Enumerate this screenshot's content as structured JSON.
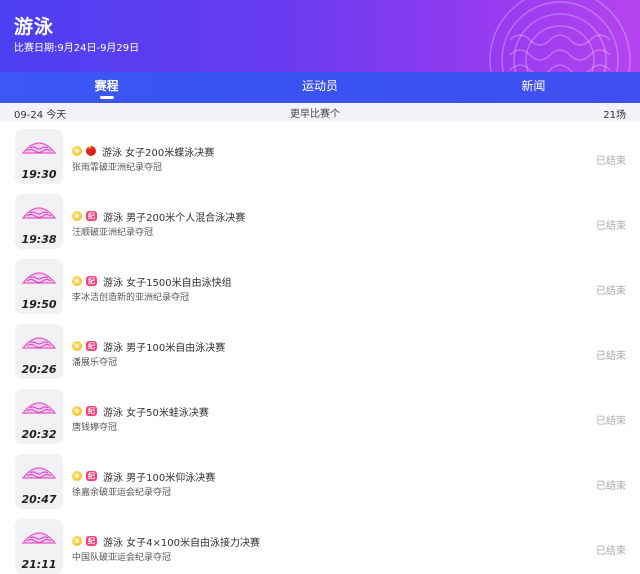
{
  "header": {
    "title": "游泳",
    "date_range": "比赛日期:9月24日-9月29日",
    "colors": {
      "gradient_start": "#4d3ff2",
      "gradient_end": "#b545ee",
      "tab_bar": "#3b57f4"
    }
  },
  "tabs": [
    {
      "label": "赛程",
      "active": true
    },
    {
      "label": "运动员",
      "active": false
    },
    {
      "label": "新闻",
      "active": false
    }
  ],
  "date_bar": {
    "date": "09-24 今天",
    "earlier_label": "更早比赛个",
    "count": "21场"
  },
  "events": [
    {
      "time": "19:30",
      "badge": "china-flag-icon",
      "title": "游泳 女子200米蝶泳决赛",
      "subtitle": "张雨霏破亚洲纪录夺冠",
      "status": "已结束"
    },
    {
      "time": "19:38",
      "badge": "record-icon",
      "title": "游泳 男子200米个人混合泳决赛",
      "subtitle": "汪顺破亚洲纪录夺冠",
      "status": "已结束"
    },
    {
      "time": "19:50",
      "badge": "record-icon",
      "title": "游泳 女子1500米自由泳快组",
      "subtitle": "李冰洁创造新的亚洲纪录夺冠",
      "status": "已结束"
    },
    {
      "time": "20:26",
      "badge": "record-icon",
      "title": "游泳 男子100米自由泳决赛",
      "subtitle": "潘展乐夺冠",
      "status": "已结束"
    },
    {
      "time": "20:32",
      "badge": "record-icon",
      "title": "游泳 女子50米蛙泳决赛",
      "subtitle": "唐钱婷夺冠",
      "status": "已结束"
    },
    {
      "time": "20:47",
      "badge": "record-icon",
      "title": "游泳 男子100米仰泳决赛",
      "subtitle": "徐嘉余破亚运会纪录夺冠",
      "status": "已结束"
    },
    {
      "time": "21:11",
      "badge": "record-icon",
      "title": "游泳 女子4×100米自由泳接力决赛",
      "subtitle": "中国队破亚运会纪录夺冠",
      "status": "已结束"
    }
  ]
}
